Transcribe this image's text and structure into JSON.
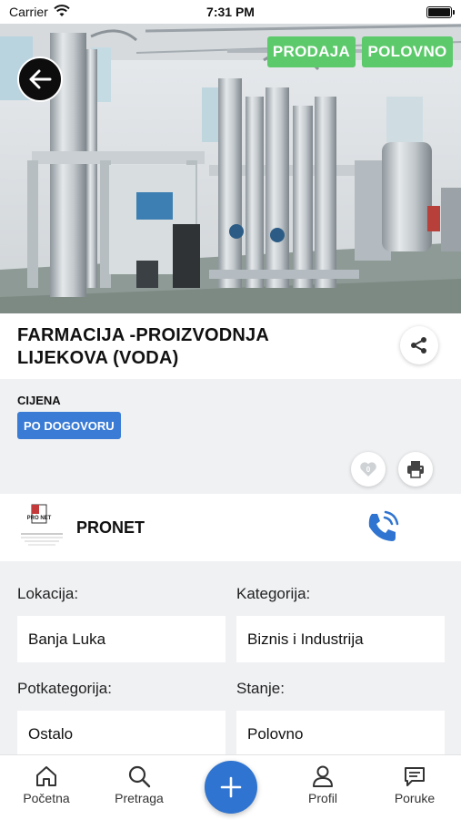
{
  "status_bar": {
    "carrier": "Carrier",
    "time": "7:31 PM"
  },
  "listing": {
    "tags": {
      "type": "PRODAJA",
      "condition": "POLOVNO"
    },
    "title": "FARMACIJA -PROIZVODNJA LIJEKOVA (VODA)",
    "price_label": "CIJENA",
    "price_value": "PO DOGOVORU"
  },
  "seller": {
    "name": "PRONET",
    "logo_text": "PRO NET"
  },
  "details": [
    {
      "label": "Lokacija:",
      "value": "Banja Luka"
    },
    {
      "label": "Kategorija:",
      "value": "Biznis i Industrija"
    },
    {
      "label": "Potkategorija:",
      "value": "Ostalo"
    },
    {
      "label": "Stanje:",
      "value": "Polovno"
    }
  ],
  "tab_bar": {
    "home": "Početna",
    "search": "Pretraga",
    "profile": "Profil",
    "messages": "Poruke"
  },
  "colors": {
    "accent": "#2f74d0",
    "tag_green": "#5cc96b",
    "price_badge": "#3a7bd5"
  },
  "icons": [
    "wifi-icon",
    "battery-icon",
    "back-arrow-icon",
    "share-icon",
    "heart-icon",
    "printer-icon",
    "phone-icon",
    "home-icon",
    "search-icon",
    "plus-icon",
    "profile-icon",
    "chat-icon"
  ]
}
